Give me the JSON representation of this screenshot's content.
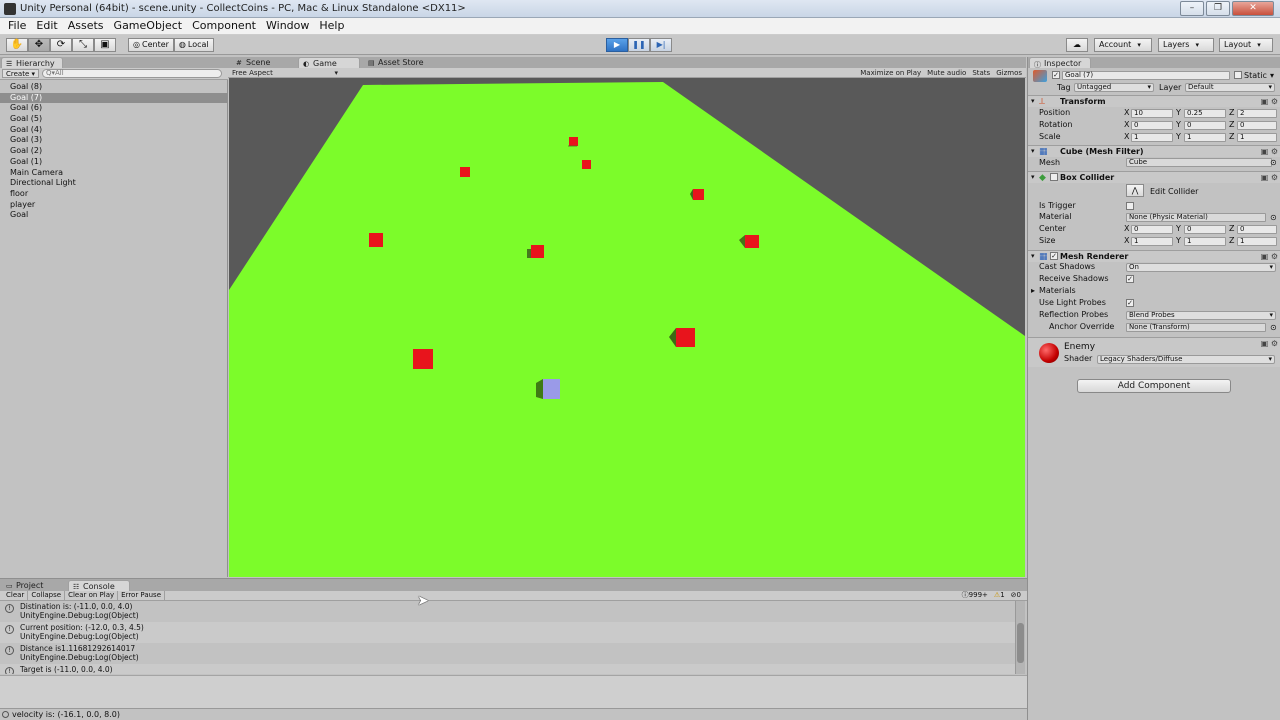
{
  "window": {
    "title": "Unity Personal (64bit) - scene.unity - CollectCoins - PC, Mac & Linux Standalone <DX11>",
    "buttons": [
      "–",
      "❐",
      "✕"
    ]
  },
  "menu": [
    "File",
    "Edit",
    "Assets",
    "GameObject",
    "Component",
    "Window",
    "Help"
  ],
  "toolbar": {
    "pivot": "Center",
    "space": "Local",
    "account": "Account",
    "layers": "Layers",
    "layout": "Layout"
  },
  "hierarchy": {
    "tab": "Hierarchy",
    "create": "Create",
    "search_placeholder": "Q▾All",
    "items": [
      {
        "label": "Goal (8)",
        "selected": false
      },
      {
        "label": "Goal (7)",
        "selected": true
      },
      {
        "label": "Goal (6)",
        "selected": false
      },
      {
        "label": "Goal (5)",
        "selected": false
      },
      {
        "label": "Goal (4)",
        "selected": false
      },
      {
        "label": "Goal (3)",
        "selected": false
      },
      {
        "label": "Goal (2)",
        "selected": false
      },
      {
        "label": "Goal (1)",
        "selected": false
      },
      {
        "label": "Main Camera",
        "selected": false
      },
      {
        "label": "Directional Light",
        "selected": false
      },
      {
        "label": "floor",
        "selected": false
      },
      {
        "label": "player",
        "selected": false
      },
      {
        "label": "Goal",
        "selected": false
      }
    ]
  },
  "center": {
    "tabs": [
      "Scene",
      "Game",
      "Asset Store"
    ],
    "aspect": "Free Aspect",
    "options": [
      "Maximize on Play",
      "Mute audio",
      "Stats",
      "Gizmos"
    ]
  },
  "inspector": {
    "tab": "Inspector",
    "object_name": "Goal (7)",
    "static_label": "Static",
    "tag_label": "Tag",
    "tag_value": "Untagged",
    "layer_label": "Layer",
    "layer_value": "Default",
    "transform": {
      "name": "Transform",
      "position_label": "Position",
      "rotation_label": "Rotation",
      "scale_label": "Scale",
      "position": [
        "10",
        "0.25",
        "2"
      ],
      "rotation": [
        "0",
        "0",
        "0"
      ],
      "scale": [
        "1",
        "1",
        "1"
      ]
    },
    "mesh_filter": {
      "name": "Cube (Mesh Filter)",
      "mesh_label": "Mesh",
      "mesh_value": "Cube"
    },
    "box_collider": {
      "name": "Box Collider",
      "edit_label": "Edit Collider",
      "trigger_label": "Is Trigger",
      "material_label": "Material",
      "material_value": "None (Physic Material)",
      "center_label": "Center",
      "size_label": "Size",
      "center": [
        "0",
        "0",
        "0"
      ],
      "size": [
        "1",
        "1",
        "1"
      ]
    },
    "mesh_renderer": {
      "name": "Mesh Renderer",
      "cast_label": "Cast Shadows",
      "cast_value": "On",
      "receive_label": "Receive Shadows",
      "materials_label": "Materials",
      "probes_label": "Use Light Probes",
      "reflection_label": "Reflection Probes",
      "reflection_value": "Blend Probes",
      "anchor_label": "Anchor Override",
      "anchor_value": "None (Transform)"
    },
    "material": {
      "name": "Enemy",
      "shader_label": "Shader",
      "shader_value": "Legacy Shaders/Diffuse"
    },
    "add_component": "Add Component"
  },
  "bottom": {
    "tabs": [
      "Project",
      "Console"
    ],
    "console_buttons": [
      "Clear",
      "Collapse",
      "Clear on Play",
      "Error Pause"
    ],
    "counts": {
      "info": "999+",
      "warn": "1",
      "error": "0"
    },
    "logs": [
      {
        "line1": "Distination is: (-11.0, 0.0, 4.0)",
        "line2": "UnityEngine.Debug:Log(Object)"
      },
      {
        "line1": "Current position: (-12.0, 0.3, 4.5)",
        "line2": "UnityEngine.Debug:Log(Object)"
      },
      {
        "line1": "Distance is1.11681292614017",
        "line2": "UnityEngine.Debug:Log(Object)"
      },
      {
        "line1": "Target is (-11.0, 0.0, 4.0)",
        "line2": ""
      }
    ]
  },
  "status": "velocity is: (-16.1, 0.0, 8.0)",
  "colors": {
    "floor": "#7cfc2a",
    "enemy": "#e8141c",
    "player": "#9a9ae8",
    "sky": "#595959",
    "play_active": "#3a86d8"
  }
}
